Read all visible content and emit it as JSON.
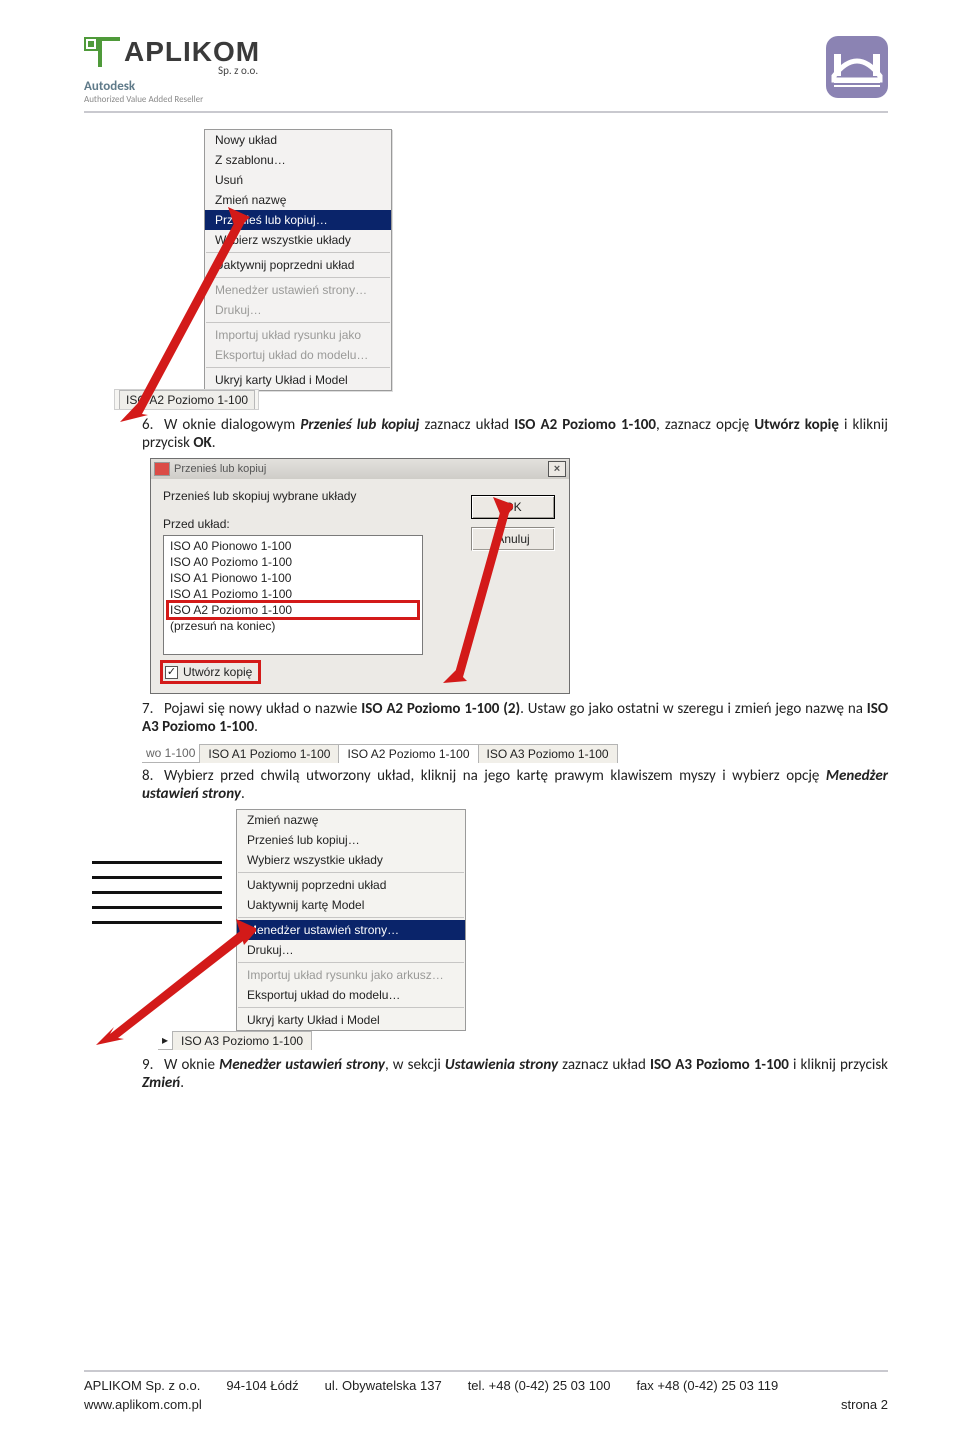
{
  "header": {
    "logo_text": "APLIKOM",
    "spzoo": "Sp. z o.o.",
    "autodesk": "Autodesk",
    "autodesk_sub": "Authorized Value Added Reseller"
  },
  "menu1": {
    "items": [
      {
        "label": "Nowy układ"
      },
      {
        "label": "Z szablonu…"
      },
      {
        "label": "Usuń"
      },
      {
        "label": "Zmień nazwę"
      },
      {
        "label": "Przenieś lub kopiuj…",
        "hl": true
      },
      {
        "label": "Wybierz wszystkie układy"
      }
    ],
    "group2": [
      {
        "label": "Uaktywnij poprzedni układ"
      }
    ],
    "group3": [
      {
        "label": "Menedżer ustawień strony…",
        "dim": true
      },
      {
        "label": "Drukuj…",
        "dim": true
      }
    ],
    "group4": [
      {
        "label": "Importuj układ rysunku jako",
        "dim": true
      },
      {
        "label": "Eksportuj układ do modelu…",
        "dim": true
      }
    ],
    "group5": [
      {
        "label": "Ukryj karty Układ i Model"
      }
    ],
    "tab": "ISO A2 Poziomo 1-100"
  },
  "step6": {
    "num": "6.",
    "t1": "W oknie dialogowym ",
    "b1": "Przenieś lub kopiuj",
    "t2": " zaznacz układ ",
    "b2": "ISO A2 Poziomo 1-100",
    "t3": ", zaznacz opcję ",
    "b3": "Utwórz kopię",
    "t4": " i kliknij przycisk ",
    "b4": "OK",
    "t5": "."
  },
  "dialog": {
    "title": "Przenieś lub kopiuj",
    "prompt": "Przenieś lub skopiuj wybrane układy",
    "ok": "OK",
    "cancel": "Anuluj",
    "listlbl": "Przed układ:",
    "list": [
      "ISO A0 Pionowo 1-100",
      "ISO A0 Poziomo 1-100",
      "ISO A1 Pionowo 1-100",
      "ISO A1 Poziomo 1-100",
      "ISO A2 Poziomo 1-100",
      "(przesuń na koniec)"
    ],
    "chk": "Utwórz kopię"
  },
  "step7": {
    "num": "7.",
    "t1": "Pojawi się nowy układ o nazwie ",
    "b1": "ISO A2 Poziomo 1-100 (2)",
    "t2": ". Ustaw go jako ostatni w szeregu i zmień jego nazwę na ",
    "b2": "ISO A3 Poziomo 1-100",
    "t3": "."
  },
  "tabs2": {
    "pre": "wo 1-100",
    "t1": "ISO A1 Poziomo 1-100",
    "t2": "ISO A2 Poziomo 1-100",
    "t3": "ISO A3 Poziomo 1-100"
  },
  "step8": {
    "num": "8.",
    "t1": "Wybierz przed chwilą utworzony układ, kliknij na jego kartę prawym klawiszem myszy i wybierz opcję ",
    "b1": "Menedżer ustawień strony",
    "t2": "."
  },
  "menu2": {
    "g1": [
      {
        "label": "Zmień nazwę"
      },
      {
        "label": "Przenieś lub kopiuj…"
      },
      {
        "label": "Wybierz wszystkie układy"
      }
    ],
    "g2": [
      {
        "label": "Uaktywnij poprzedni układ"
      },
      {
        "label": "Uaktywnij kartę Model"
      }
    ],
    "g3": [
      {
        "label": "Menedżer ustawień strony…",
        "hl": true
      },
      {
        "label": "Drukuj…"
      }
    ],
    "g4": [
      {
        "label": "Importuj układ rysunku jako arkusz…",
        "dim": true
      },
      {
        "label": "Eksportuj układ do modelu…"
      }
    ],
    "g5": [
      {
        "label": "Ukryj karty Układ i Model"
      }
    ],
    "tab": "ISO A3 Poziomo 1-100"
  },
  "step9": {
    "num": "9.",
    "t1": "W oknie ",
    "b1": "Menedżer ustawień strony",
    "t2": ", w sekcji ",
    "b2": "Ustawienia strony",
    "t3": " zaznacz układ ",
    "b3": "ISO A3 Poziomo 1-100",
    "t4": " i kliknij przycisk ",
    "b4": "Zmień",
    "t5": "."
  },
  "footer": {
    "company": "APLIKOM Sp. z o.o.",
    "city": "94-104 Łódź",
    "street": "ul. Obywatelska 137",
    "tel": "tel. +48 (0-42) 25 03 100",
    "fax": "fax  +48 (0-42) 25 03 119",
    "web": "www.aplikom.com.pl",
    "page": "strona 2"
  }
}
